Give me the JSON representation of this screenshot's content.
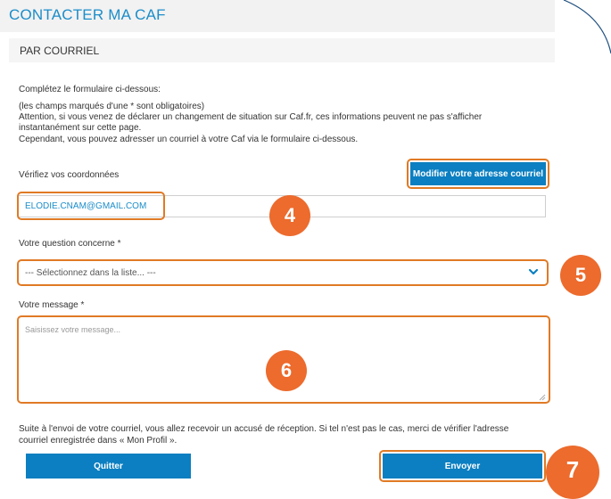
{
  "header": {
    "title": "CONTACTER MA CAF"
  },
  "section": {
    "title": "PAR COURRIEL"
  },
  "intro": {
    "line1": "Complétez le formulaire ci-dessous:",
    "line2": "(les champs marqués d'une * sont obligatoires)",
    "line3": "Attention, si vous venez de déclarer un changement de situation sur Caf.fr, ces informations peuvent ne pas s'afficher",
    "line4": "instantanément sur cette page.",
    "line5": "Cependant, vous pouvez adresser un courriel à votre Caf via le formulaire ci-dessous."
  },
  "coords": {
    "label": "Vérifiez vos coordonnées",
    "modify_button": "Modifier votre adresse courriel",
    "email": "ELODIE.CNAM@GMAIL.COM"
  },
  "question": {
    "label": "Votre question concerne *",
    "selected": "--- Sélectionnez dans la liste... ---"
  },
  "message": {
    "label": "Votre message *",
    "placeholder": "Saisissez votre message..."
  },
  "footer": {
    "line1": "Suite à l'envoi de votre courriel, vous allez recevoir un accusé de réception. Si tel n'est pas le cas, merci de vérifier l'adresse",
    "line2": "courriel enregistrée dans « Mon Profil ».",
    "quit_button": "Quitter",
    "send_button": "Envoyer"
  },
  "badges": {
    "b4": "4",
    "b5": "5",
    "b6": "6",
    "b7": "7"
  },
  "colors": {
    "brand_blue": "#0b7fc1",
    "title_blue": "#1c8dc9",
    "highlight_orange": "#e07a25",
    "badge_orange": "#ec6b2d"
  }
}
